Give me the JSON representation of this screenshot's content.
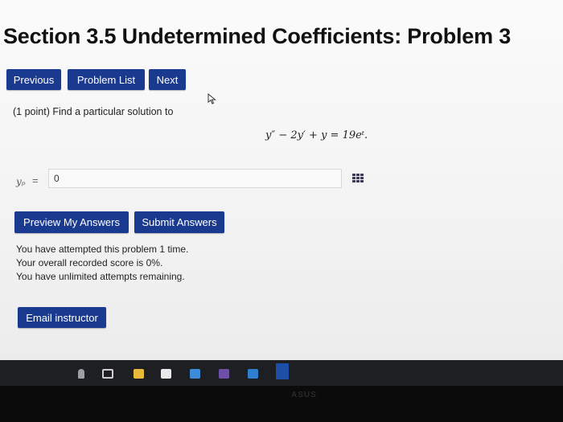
{
  "page": {
    "title": "Section 3.5 Undetermined Coefficients: Problem 3"
  },
  "nav": {
    "previous": "Previous",
    "problem_list": "Problem List",
    "next": "Next"
  },
  "problem": {
    "prompt": "(1 point) Find a particular solution to",
    "equation": "y″ − 2y′ + y = 19eᵗ.",
    "answer_label": "yₚ",
    "answer_equals": "=",
    "answer_value": "0"
  },
  "actions": {
    "preview": "Preview My Answers",
    "submit": "Submit Answers"
  },
  "status": {
    "attempts": "You have attempted this problem 1 time.",
    "score": "Your overall recorded score is 0%.",
    "remaining": "You have unlimited attempts remaining."
  },
  "footer": {
    "email": "Email instructor"
  },
  "bezel": {
    "logo": "ASUS"
  },
  "colors": {
    "button": "#1a3a8f",
    "taskbar": "#1d1f22"
  },
  "taskbar": {
    "icons": [
      "microphone-icon",
      "task-view-icon",
      "file-explorer-icon",
      "mail-icon",
      "store-icon",
      "media-icon",
      "app-icon",
      "browser-icon"
    ]
  }
}
